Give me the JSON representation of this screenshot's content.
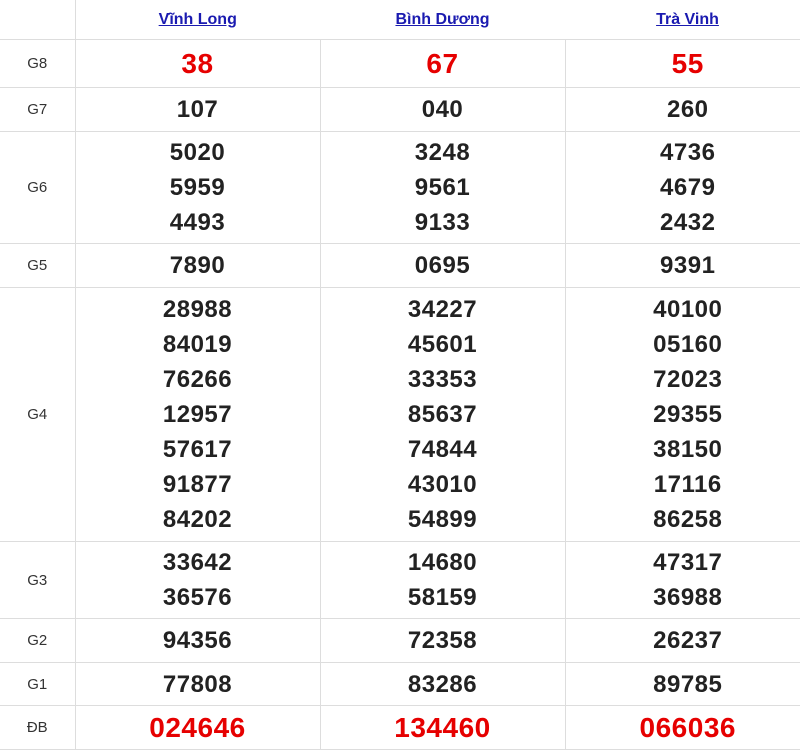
{
  "provinces": [
    "Vĩnh Long",
    "Bình Dương",
    "Trà Vinh"
  ],
  "colors": {
    "accent_red": "#e60000",
    "link_blue": "#1a1ab0",
    "number": "#222222"
  },
  "prizes": [
    {
      "label": "G8",
      "results": [
        [
          "38"
        ],
        [
          "67"
        ],
        [
          "55"
        ]
      ]
    },
    {
      "label": "G7",
      "results": [
        [
          "107"
        ],
        [
          "040"
        ],
        [
          "260"
        ]
      ]
    },
    {
      "label": "G6",
      "results": [
        [
          "5020",
          "5959",
          "4493"
        ],
        [
          "3248",
          "9561",
          "9133"
        ],
        [
          "4736",
          "4679",
          "2432"
        ]
      ]
    },
    {
      "label": "G5",
      "results": [
        [
          "7890"
        ],
        [
          "0695"
        ],
        [
          "9391"
        ]
      ]
    },
    {
      "label": "G4",
      "results": [
        [
          "28988",
          "84019",
          "76266",
          "12957",
          "57617",
          "91877",
          "84202"
        ],
        [
          "34227",
          "45601",
          "33353",
          "85637",
          "74844",
          "43010",
          "54899"
        ],
        [
          "40100",
          "05160",
          "72023",
          "29355",
          "38150",
          "17116",
          "86258"
        ]
      ]
    },
    {
      "label": "G3",
      "results": [
        [
          "33642",
          "36576"
        ],
        [
          "14680",
          "58159"
        ],
        [
          "47317",
          "36988"
        ]
      ]
    },
    {
      "label": "G2",
      "results": [
        [
          "94356"
        ],
        [
          "72358"
        ],
        [
          "26237"
        ]
      ]
    },
    {
      "label": "G1",
      "results": [
        [
          "77808"
        ],
        [
          "83286"
        ],
        [
          "89785"
        ]
      ]
    },
    {
      "label": "ĐB",
      "results": [
        [
          "024646"
        ],
        [
          "134460"
        ],
        [
          "066036"
        ]
      ]
    }
  ]
}
